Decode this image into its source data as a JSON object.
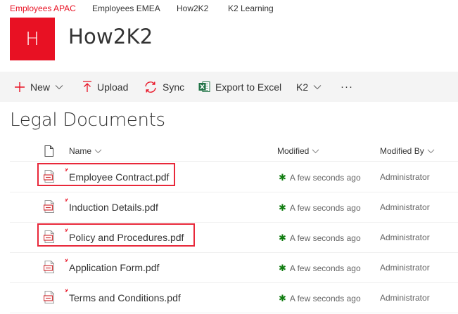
{
  "top_nav": [
    "Employees APAC",
    "Employees EMEA",
    "How2K2",
    "K2 Learning"
  ],
  "site": {
    "logo_letter": "H",
    "title": "How2K2",
    "brand_color": "#e81123"
  },
  "command_bar": {
    "new": "New",
    "upload": "Upload",
    "sync": "Sync",
    "export": "Export to Excel",
    "k2": "K2",
    "more": "···"
  },
  "list_title": "Legal Documents",
  "columns": {
    "name": "Name",
    "modified": "Modified",
    "modified_by": "Modified By"
  },
  "files": [
    {
      "name": "Employee Contract.pdf",
      "modified": "A few seconds ago",
      "modified_by": "Administrator",
      "highlighted": true
    },
    {
      "name": "Induction Details.pdf",
      "modified": "A few seconds ago",
      "modified_by": "Administrator",
      "highlighted": false
    },
    {
      "name": "Policy and Procedures.pdf",
      "modified": "A few seconds ago",
      "modified_by": "Administrator",
      "highlighted": true
    },
    {
      "name": "Application Form.pdf",
      "modified": "A few seconds ago",
      "modified_by": "Administrator",
      "highlighted": false
    },
    {
      "name": "Terms and Conditions.pdf",
      "modified": "A few seconds ago",
      "modified_by": "Administrator",
      "highlighted": false
    }
  ],
  "icons": [
    "add-icon",
    "upload-icon",
    "sync-icon",
    "excel-icon",
    "chevron-down-icon",
    "document-icon",
    "pdf-file-icon",
    "new-item-icon"
  ]
}
